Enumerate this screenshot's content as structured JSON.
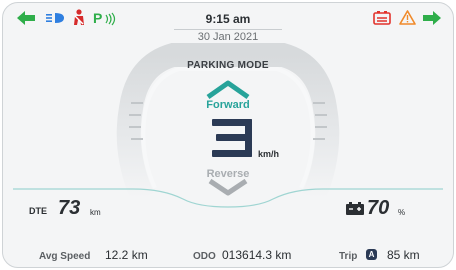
{
  "header": {
    "time": "9:15 am",
    "date": "30 Jan 2021",
    "indicators_left": [
      "left-turn-arrow-icon",
      "headlight-icon",
      "seatbelt-icon",
      "parking-light-icon"
    ],
    "indicators_right": [
      "battery-warning-icon",
      "warning-triangle-icon",
      "right-turn-arrow-icon"
    ],
    "colors": {
      "turn_signal": "#2fae4a",
      "headlight": "#2f7fe0",
      "seatbelt": "#d62b2b",
      "parking": "#2fae4a",
      "battery_warning": "#e2322b",
      "hazard": "#f08a2a"
    }
  },
  "gauge": {
    "mode": "PARKING MODE",
    "forward_label": "Forward",
    "reverse_label": "Reverse",
    "speed_unit": "km/h",
    "speed_digit": "3",
    "forward_active": true,
    "accent": "#27a39a"
  },
  "range": {
    "dte_label": "DTE",
    "dte_value": "73",
    "dte_unit": "km",
    "battery_value": "70",
    "battery_unit": "%"
  },
  "stats": {
    "avg_speed_label": "Avg Speed",
    "avg_speed_value": "12.2 km",
    "odo_label": "ODO",
    "odo_value": "013614.3 km",
    "trip_label": "Trip",
    "trip_badge": "A",
    "trip_value": "85 km"
  }
}
